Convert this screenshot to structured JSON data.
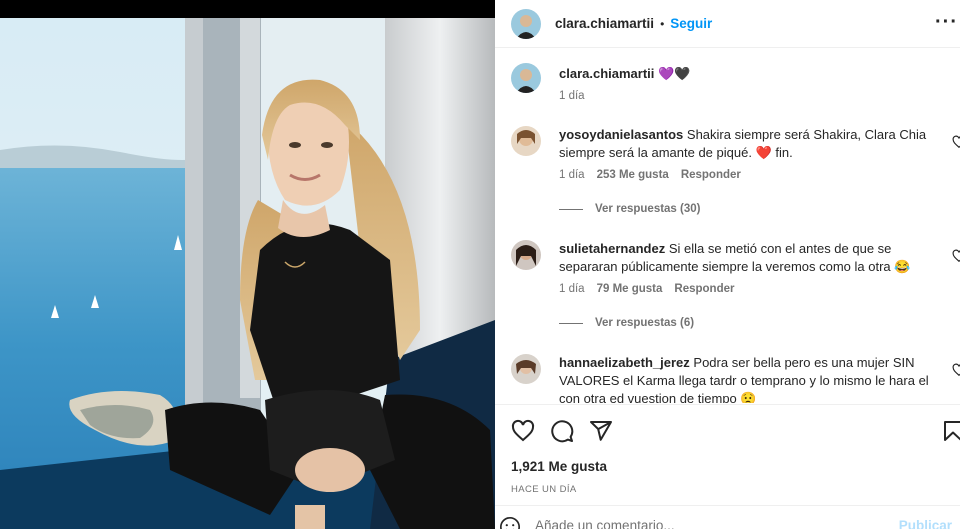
{
  "post": {
    "photo_description_icon": "portrait-photo",
    "author": "clara.chiamartii",
    "follow_label": "Seguir",
    "more_icon": "more-icon"
  },
  "caption": {
    "author": "clara.chiamartii",
    "emojis": "💜🖤",
    "age": "1 día"
  },
  "comments": [
    {
      "user": "yosoydanielasantos",
      "text": "Shakira siempre será Shakira, Clara Chia siempre será la amante de piqué. ❤️ fin.",
      "age": "1 día",
      "likes": "253 Me gusta",
      "reply": "Responder",
      "view_replies": "Ver respuestas (30)"
    },
    {
      "user": "sulietahernandez",
      "text": "Si ella se metió con el antes de que se separaran públicamente siempre la veremos como la otra 😂",
      "age": "1 día",
      "likes": "79 Me gusta",
      "reply": "Responder",
      "view_replies": "Ver respuestas (6)"
    },
    {
      "user": "hannaelizabeth_jerez",
      "text": "Podra ser bella pero es una mujer SIN VALORES el Karma llega tardr o temprano y lo mismo le hara el con otra ed vuestion de tiempo 😟"
    }
  ],
  "footer": {
    "likes": "1,921 Me gusta",
    "time": "HACE UN DÍA",
    "comment_placeholder": "Añade un comentario...",
    "publish_label": "Publicar"
  },
  "colors": {
    "accent": "#0095f6",
    "publish_disabled": "#b2dffc",
    "secondary_text": "#737373"
  }
}
